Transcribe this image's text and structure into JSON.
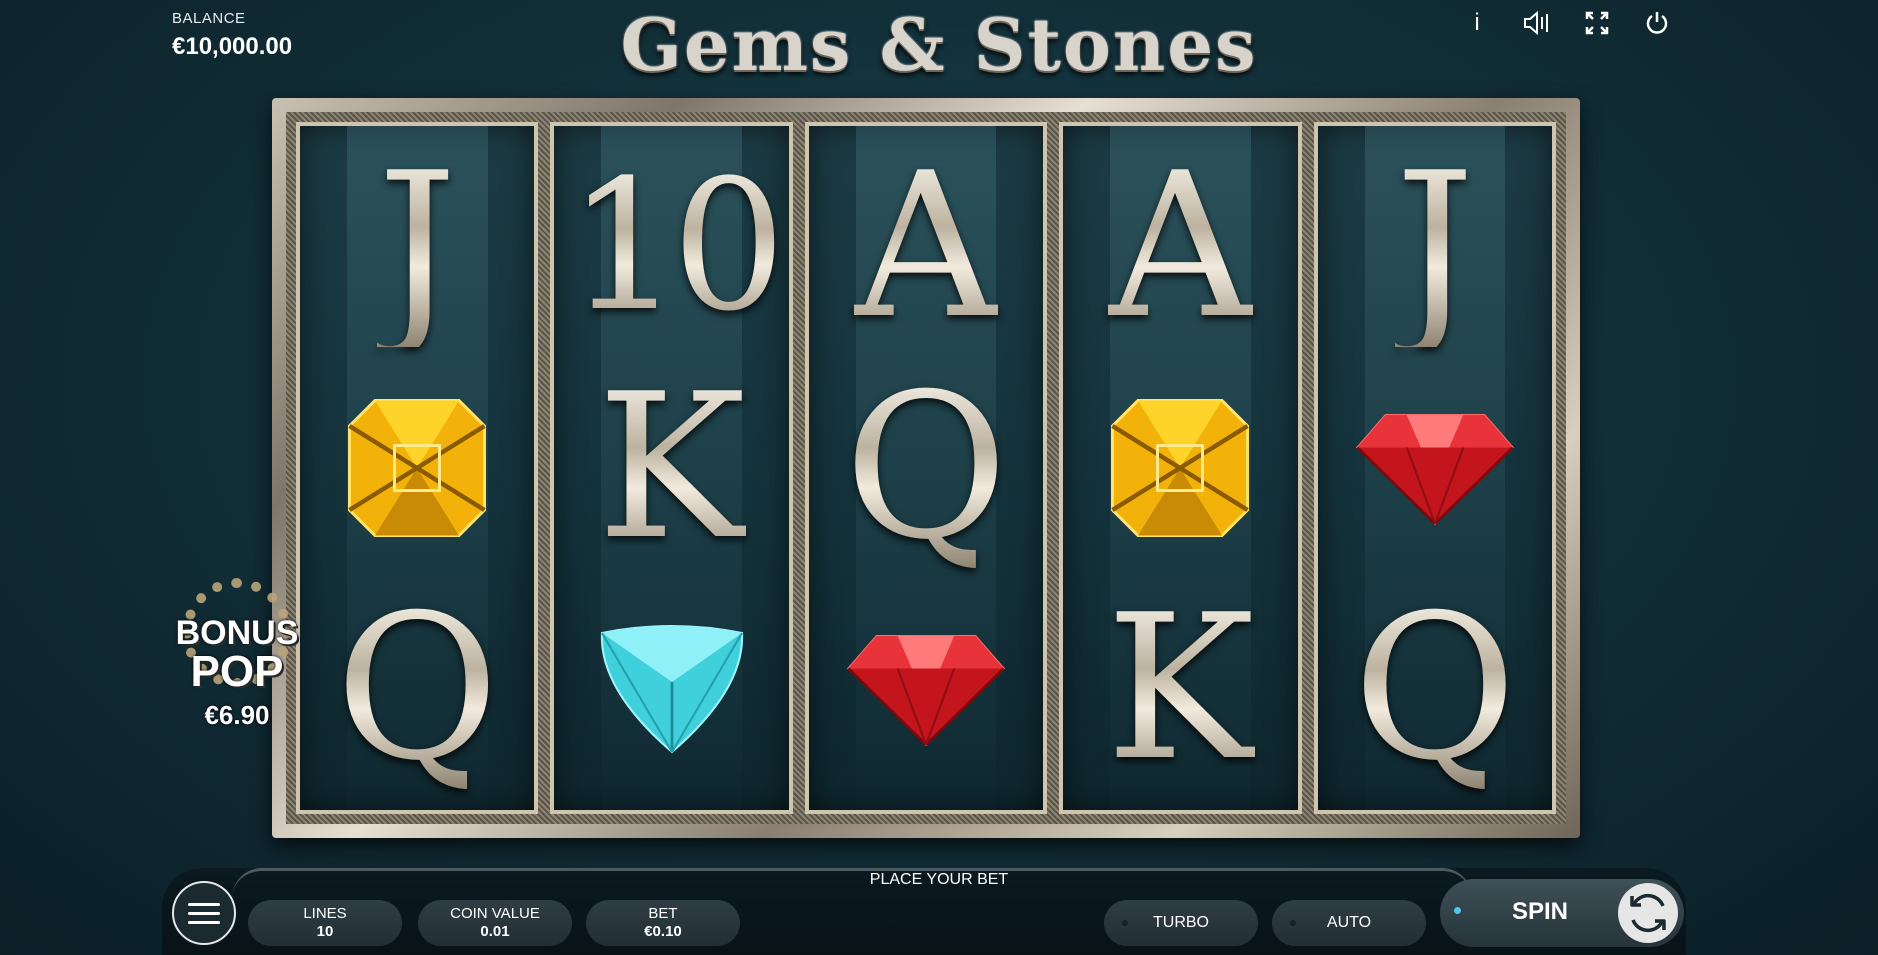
{
  "header": {
    "balance_label": "BALANCE",
    "balance_value": "€10,000.00",
    "title": "Gems & Stones"
  },
  "top_icons": [
    {
      "name": "info-icon",
      "glyph": "i"
    },
    {
      "name": "sound-icon",
      "glyph": "🔊"
    },
    {
      "name": "fullscreen-icon",
      "glyph": "⛶"
    },
    {
      "name": "power-icon",
      "glyph": "⏻"
    }
  ],
  "reels": [
    [
      "J",
      "yellow-gem",
      "Q"
    ],
    [
      "10",
      "K",
      "blue-gem"
    ],
    [
      "A",
      "Q",
      "red-gem"
    ],
    [
      "A",
      "yellow-gem",
      "K"
    ],
    [
      "J",
      "red-gem",
      "Q"
    ]
  ],
  "colors": {
    "yellow_gem": "#f2b20a",
    "red_gem": "#c4141c",
    "blue_gem": "#3fd0dc",
    "spin_dot": "#4ec6f0"
  },
  "bonus": {
    "line1": "BONUS",
    "line2": "POP",
    "amount": "€6.90"
  },
  "controls": {
    "place_bet": "PLACE YOUR BET",
    "lines_label": "LINES",
    "lines_value": "10",
    "coin_label": "COIN VALUE",
    "coin_value": "0.01",
    "bet_label": "BET",
    "bet_value": "€0.10",
    "turbo": "TURBO",
    "auto": "AUTO",
    "spin": "SPIN"
  }
}
